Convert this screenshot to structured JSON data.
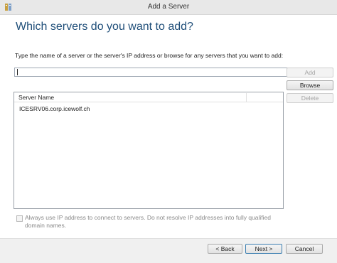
{
  "window": {
    "title": "Add a Server",
    "icon": "server-manager-icon"
  },
  "main": {
    "heading": "Which servers do you want to add?",
    "prompt": "Type the name of a server or the server's IP address or browse for any servers that you want to add:",
    "input_value": "",
    "buttons": {
      "add": "Add",
      "browse": "Browse",
      "delete": "Delete"
    },
    "list": {
      "column_header": "Server Name",
      "rows": [
        "ICESRV06.corp.icewolf.ch"
      ]
    },
    "checkbox_label": "Always use IP address to connect to servers. Do not resolve IP addresses into fully qualified domain names.",
    "checkbox_checked": false
  },
  "footer": {
    "back": "< Back",
    "next": "Next >",
    "cancel": "Cancel"
  }
}
